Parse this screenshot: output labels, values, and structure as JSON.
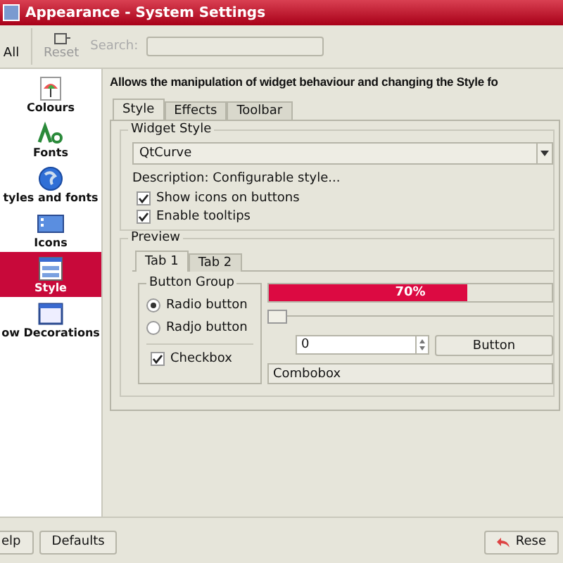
{
  "window": {
    "title": "Appearance - System Settings"
  },
  "toolbar": {
    "buttons": [
      {
        "label": "All",
        "disabled": false
      },
      {
        "label": "Reset",
        "disabled": true
      }
    ],
    "search": {
      "label": "Search:"
    }
  },
  "sidebar": {
    "items": [
      {
        "label": "Colours",
        "kind": "colours",
        "selected": false
      },
      {
        "label": "Fonts",
        "kind": "fonts",
        "selected": false
      },
      {
        "label": "tyles and fonts",
        "kind": "globe",
        "selected": false
      },
      {
        "label": "Icons",
        "kind": "icons",
        "selected": false
      },
      {
        "label": "Style",
        "kind": "style",
        "selected": true
      },
      {
        "label": "ow Decorations",
        "kind": "window",
        "selected": false
      }
    ]
  },
  "header": "Allows the manipulation of widget behaviour and changing the Style fo",
  "tabs": [
    {
      "label": "Style",
      "selected": true
    },
    {
      "label": "Effects",
      "selected": false
    },
    {
      "label": "Toolbar",
      "selected": false
    }
  ],
  "widget_style": {
    "title": "Widget Style",
    "combo": "QtCurve",
    "description": "Description: Configurable style...",
    "options": [
      {
        "label": "Show icons on buttons",
        "checked": true
      },
      {
        "label": "Enable tooltips",
        "checked": true
      }
    ]
  },
  "preview": {
    "title": "Preview",
    "tabs": [
      {
        "label": "Tab 1",
        "selected": true
      },
      {
        "label": "Tab 2",
        "selected": false
      }
    ],
    "group": {
      "title": "Button Group",
      "radios": [
        {
          "label": "Radio button",
          "selected": true
        },
        {
          "label": "Radjo button",
          "selected": false
        }
      ],
      "checkbox": {
        "label": "Checkbox",
        "checked": true
      }
    },
    "progress": {
      "level": 0.7,
      "text": "70%"
    },
    "slider": {
      "level": 0
    },
    "spin": {
      "value": "0"
    },
    "button": "Button",
    "combo": "Combobox"
  },
  "footer": {
    "left": [
      "elp",
      "Defaults"
    ],
    "right": [
      "Rese"
    ]
  }
}
